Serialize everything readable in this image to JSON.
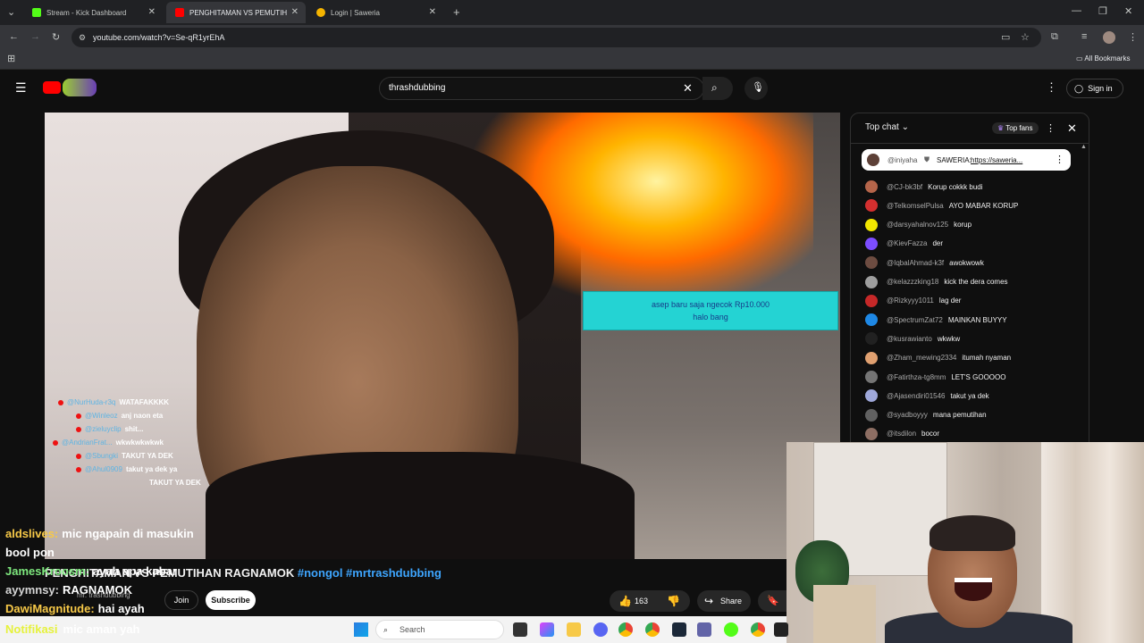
{
  "browser": {
    "tabs": [
      {
        "label": "Stream - Kick Dashboard",
        "favicon_color": "#53fc18"
      },
      {
        "label": "PENGHITAMAN VS PEMUTIH",
        "favicon_color": "#ff0000"
      },
      {
        "label": "Login | Saweria",
        "favicon_color": "#f5b400"
      }
    ],
    "url": "youtube.com/watch?v=Se-qR1yrEhA",
    "bookmarks_label": "All Bookmarks",
    "new_tab": "+"
  },
  "youtube": {
    "search_value": "thrashdubbing",
    "sign_in": "Sign in"
  },
  "video": {
    "alert_line1": "asep baru saja ngecok Rp10.000",
    "alert_line2": "halo bang",
    "overlay_chat": [
      {
        "user": "@NurHuda-r3q",
        "msg": "WATAFAKKKK"
      },
      {
        "user": "@Winleoz",
        "msg": "anj naon eta"
      },
      {
        "user": "@zieluyclip",
        "msg": "shit..."
      },
      {
        "user": "@AndrianFrat...",
        "msg": "wkwkwkwkwk"
      },
      {
        "user": "@Sbungki",
        "msg": "TAKUT YA DEK"
      },
      {
        "user": "@Ahul0909",
        "msg": "takut ya dek ya"
      },
      {
        "user": "",
        "msg": "TAKUT YA DEK"
      }
    ]
  },
  "stream_chat": [
    {
      "name": "aldslives:",
      "msg": "mic ngapain di masukin",
      "color": "#f7c948"
    },
    {
      "name": "",
      "msg": "bool pon",
      "color": "#ffffff"
    },
    {
      "name": "JamesKroosm:",
      "msg": "ayah apa kabar",
      "color": "#7ee87e"
    },
    {
      "name": "ayymnsy:",
      "msg": "RAGNAMOK",
      "color": "#d6d6d6"
    },
    {
      "name": "DawiMagnitude:",
      "msg": "hai ayah",
      "color": "#f7c948"
    }
  ],
  "notif": {
    "name": "Notifikasi",
    "msg": "mic aman yah"
  },
  "title": {
    "text": "PENGHITAMAN VS PEMUTIHAN RAGNAMOK",
    "tags": "#nongol #mrtrashdubbing",
    "channel": "mr. trashdubbing"
  },
  "actions": {
    "join": "Join",
    "subscribe": "Subscribe",
    "likes": "163",
    "share": "Share"
  },
  "live_chat": {
    "mode": "Top chat",
    "top_fans": "Top fans",
    "pinned": {
      "user": "@iniyaha",
      "text": "SAWERIA:",
      "link": "https://saweria..."
    },
    "messages": [
      {
        "user": "@CJ-bk3bf",
        "text": "Korup cokkk budi",
        "avatar": "#b5654a"
      },
      {
        "user": "@TelkomselPulsa",
        "text": "AYO MABAR KORUP",
        "avatar": "#d32f2f"
      },
      {
        "user": "@darsyahalnov125",
        "text": "korup",
        "avatar": "#f2e600"
      },
      {
        "user": "@KievFazza",
        "text": "der",
        "avatar": "#7c4dff"
      },
      {
        "user": "@IqbalAhmad-k3f",
        "text": "awokwowk",
        "avatar": "#6d4c41"
      },
      {
        "user": "@kelazzzking18",
        "text": "kick the dera comes",
        "avatar": "#9e9e9e"
      },
      {
        "user": "@Rizkyyy1011",
        "text": "lag der",
        "avatar": "#c62828"
      },
      {
        "user": "@SpectrumZat72",
        "text": "MAINKAN BUYYY",
        "avatar": "#1e88e5"
      },
      {
        "user": "@kusrawianto",
        "text": "wkwkw",
        "avatar": "#212121"
      },
      {
        "user": "@Zham_mewing2334",
        "text": "itumah nyaman",
        "avatar": "#e0a070"
      },
      {
        "user": "@Fatirthza-tg8mm",
        "text": "LET'S GOOOOO",
        "avatar": "#757575"
      },
      {
        "user": "@Ajasendiri01546",
        "text": "takut ya dek",
        "avatar": "#9fa8da"
      },
      {
        "user": "@syadboyyy",
        "text": "mana pemutihan",
        "avatar": "#616161"
      },
      {
        "user": "@itsdilon",
        "text": "bocor",
        "avatar": "#8d6e63"
      }
    ]
  },
  "taskbar": {
    "search": "Search"
  }
}
